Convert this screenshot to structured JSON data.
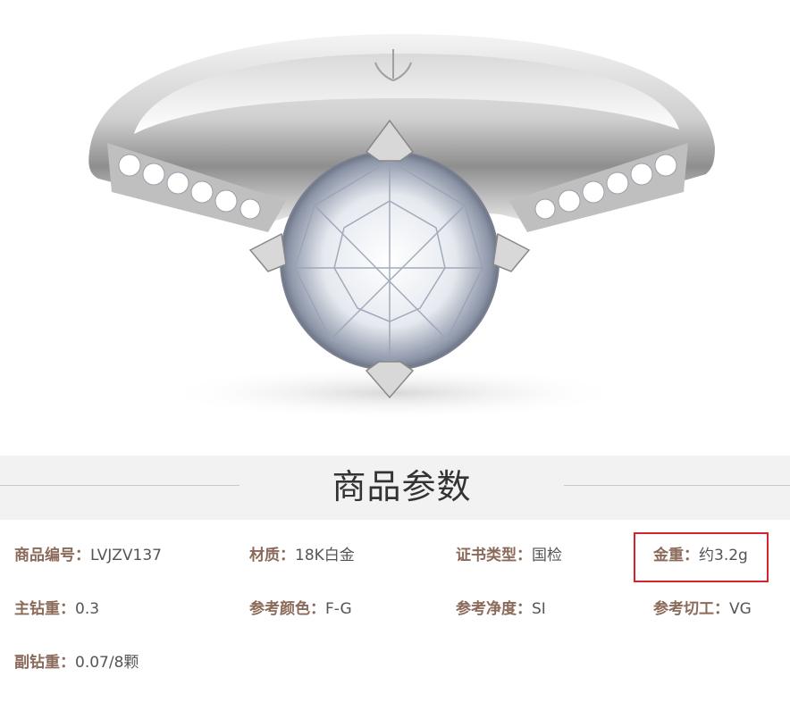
{
  "section": {
    "title": "商品参数"
  },
  "params": [
    {
      "label": "商品编号",
      "value": "LVJZV137"
    },
    {
      "label": "材质",
      "value": "18K白金"
    },
    {
      "label": "证书类型",
      "value": "国检"
    },
    {
      "label": "金重",
      "value": "约3.2g"
    },
    {
      "label": "主钻重",
      "value": "0.3"
    },
    {
      "label": "参考颜色",
      "value": "F-G"
    },
    {
      "label": "参考净度",
      "value": "SI"
    },
    {
      "label": "参考切工",
      "value": "VG"
    },
    {
      "label": "副钻重",
      "value": "0.07/8颗"
    }
  ],
  "separator": "：",
  "colors": {
    "label": "#8b6a5a",
    "value": "#555555",
    "highlight": "#d2252b",
    "header_bg": "#f2f2f2"
  }
}
